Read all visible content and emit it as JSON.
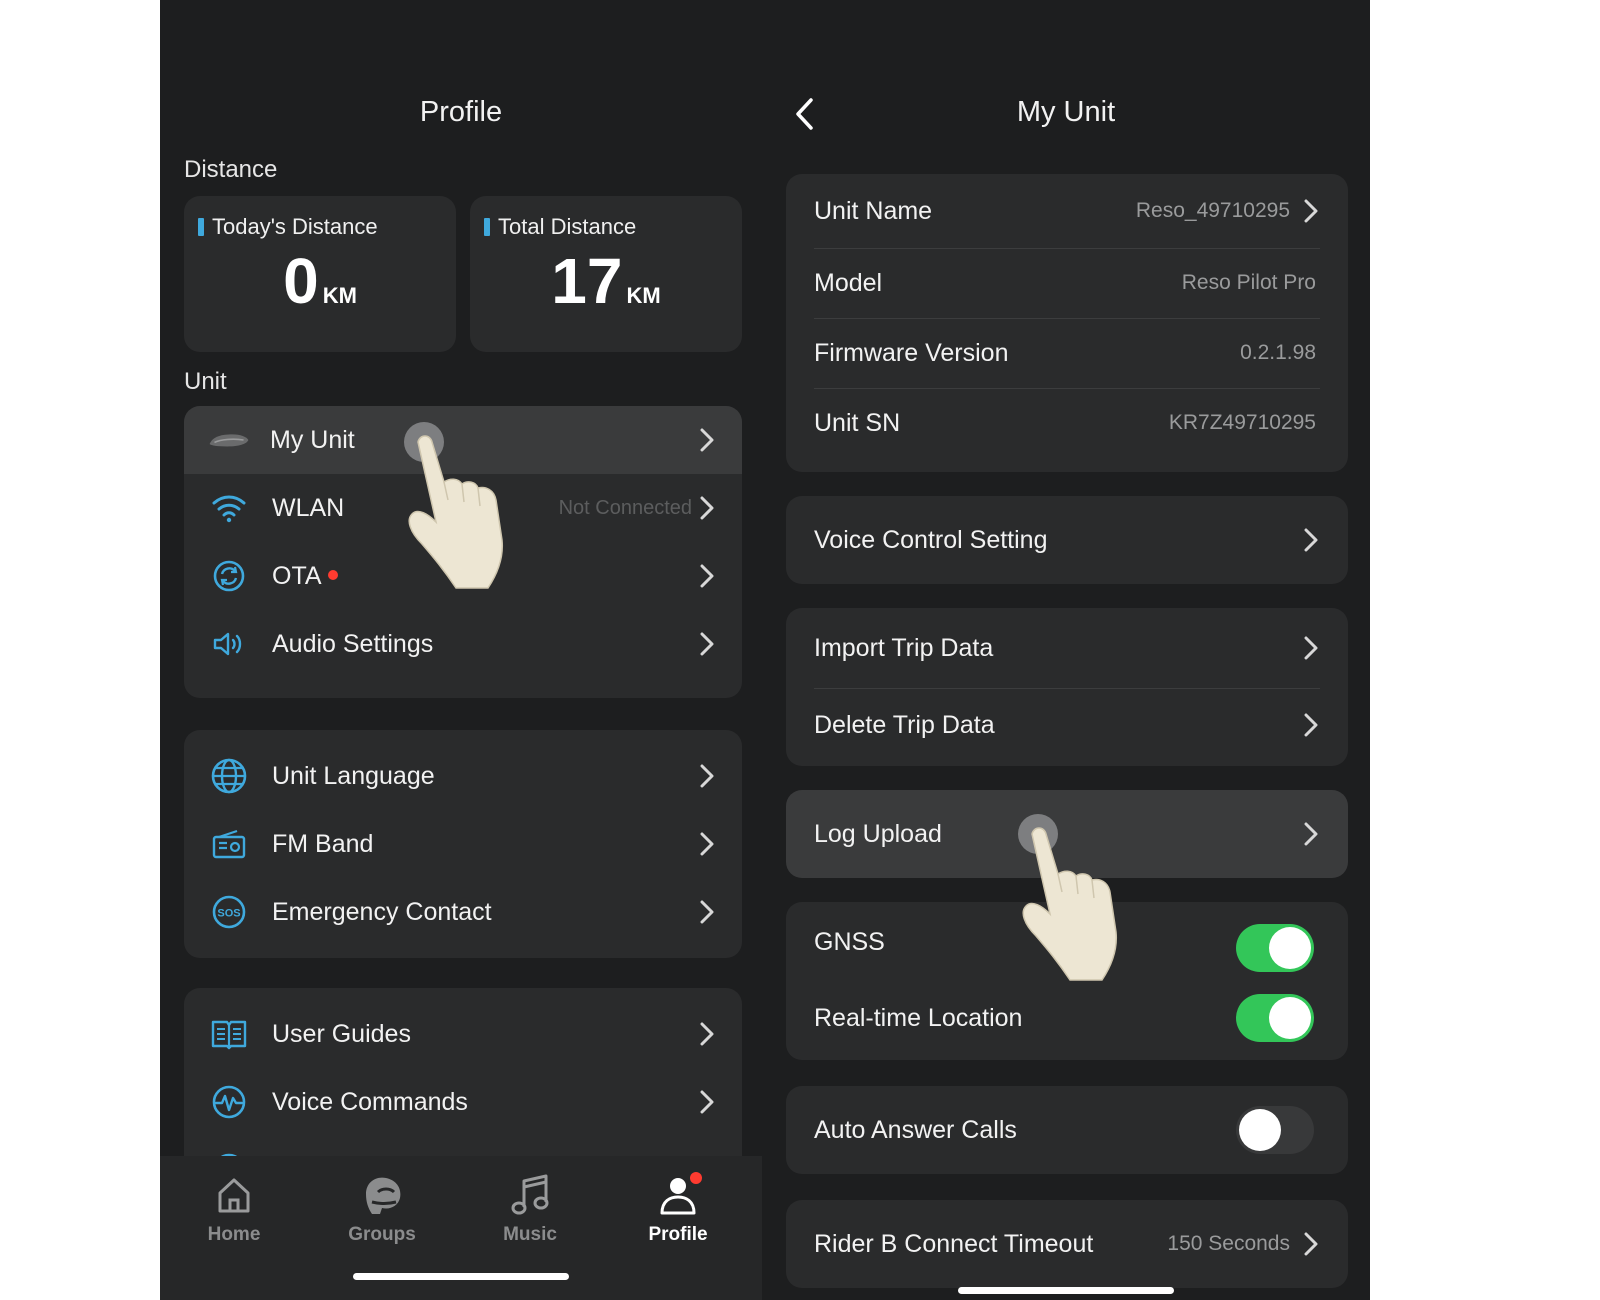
{
  "profile": {
    "title": "Profile",
    "distance_label": "Distance",
    "todays_distance": {
      "label": "Today's Distance",
      "value": "0",
      "unit": "KM"
    },
    "total_distance": {
      "label": "Total Distance",
      "value": "17",
      "unit": "KM"
    },
    "unit_label": "Unit",
    "unit_items": [
      {
        "label": "My Unit",
        "icon": "headset-device-icon"
      },
      {
        "label": "WLAN",
        "value": "Not Connected",
        "icon": "wifi-icon"
      },
      {
        "label": "OTA",
        "icon": "ota-sync-icon",
        "badge": "red-dot"
      },
      {
        "label": "Audio Settings",
        "icon": "speaker-icon"
      }
    ],
    "settings_items": [
      {
        "label": "Unit Language",
        "icon": "globe-icon"
      },
      {
        "label": "FM Band",
        "icon": "radio-icon"
      },
      {
        "label": "Emergency Contact",
        "icon": "sos-icon"
      }
    ],
    "help_items": [
      {
        "label": "User Guides",
        "icon": "book-icon"
      },
      {
        "label": "Voice Commands",
        "icon": "voice-wave-icon"
      }
    ],
    "tabs": [
      {
        "label": "Home",
        "icon": "home-icon"
      },
      {
        "label": "Groups",
        "icon": "groups-icon"
      },
      {
        "label": "Music",
        "icon": "music-icon"
      },
      {
        "label": "Profile",
        "icon": "profile-icon",
        "active": true,
        "badge": "red-dot"
      }
    ]
  },
  "my_unit": {
    "title": "My Unit",
    "info": [
      {
        "label": "Unit Name",
        "value": "Reso_49710295"
      },
      {
        "label": "Model",
        "value": "Reso Pilot Pro"
      },
      {
        "label": "Firmware Version",
        "value": "0.2.1.98"
      },
      {
        "label": "Unit SN",
        "value": "KR7Z49710295"
      }
    ],
    "voice_control": "Voice Control Setting",
    "import_trip": "Import Trip Data",
    "delete_trip": "Delete Trip Data",
    "log_upload": "Log Upload",
    "gnss": {
      "label": "GNSS",
      "on": true
    },
    "realtime_location": {
      "label": "Real-time Location",
      "on": true
    },
    "auto_answer": {
      "label": "Auto Answer Calls",
      "on": false
    },
    "rider_b_timeout": {
      "label": "Rider B Connect Timeout",
      "value": "150 Seconds"
    }
  },
  "colors": {
    "accent": "#3fa9dd",
    "toggle_on": "#33c659",
    "badge": "#ff3b30",
    "background": "#1d1e1f",
    "card": "#2a2b2c"
  }
}
